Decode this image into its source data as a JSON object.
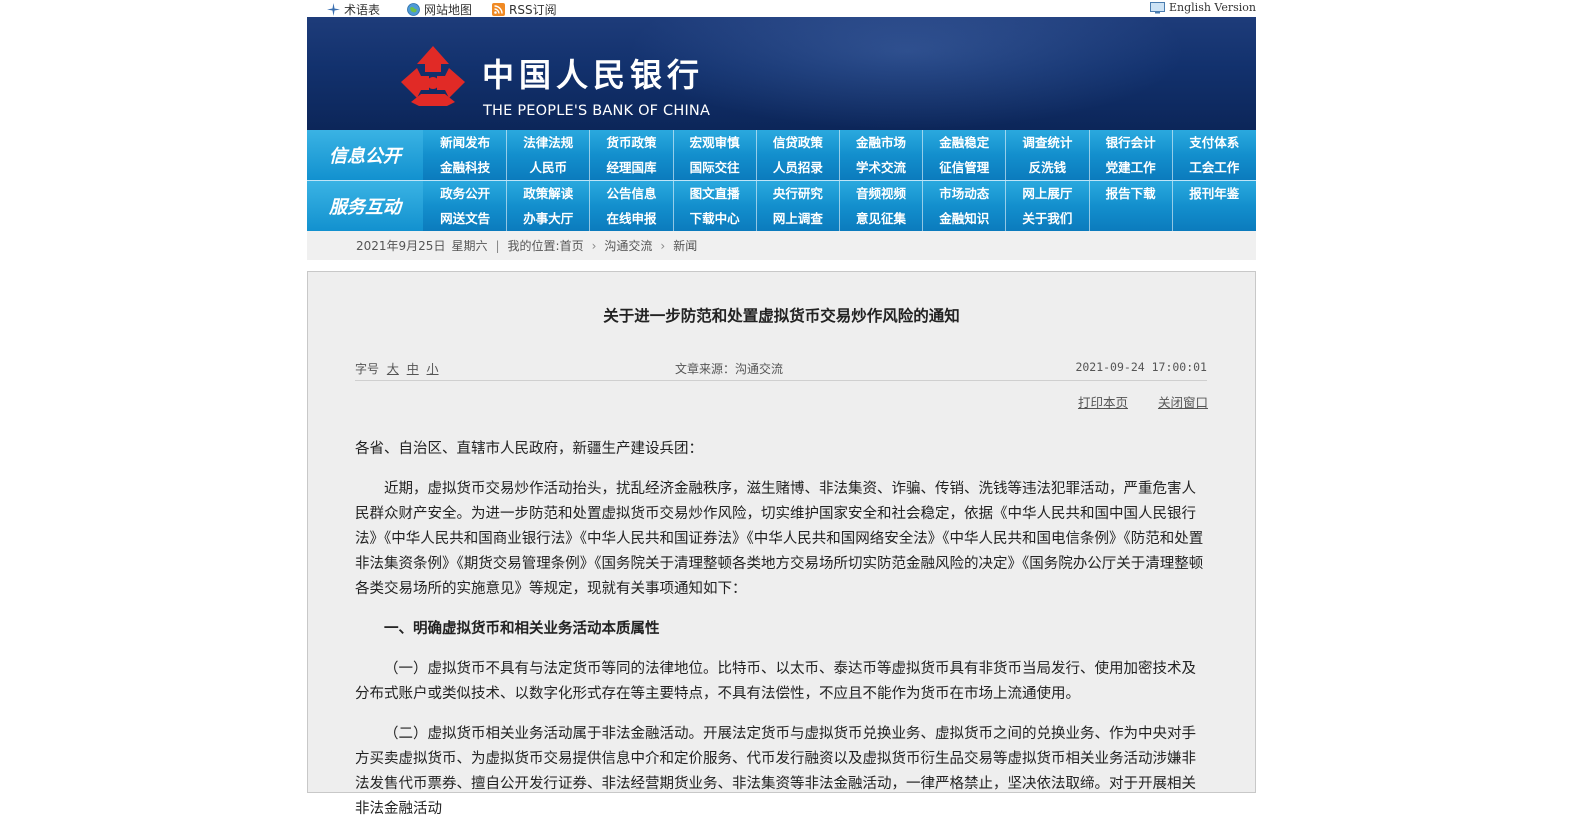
{
  "topbar": {
    "glossary": "术语表",
    "sitemap": "网站地图",
    "rss": "RSS订阅",
    "english": "English Version"
  },
  "banner": {
    "name_cn": "中国人民银行",
    "name_en": "THE PEOPLE'S BANK OF CHINA",
    "colors": {
      "emblem": "#e12a26",
      "banner_bg": "#12316d"
    }
  },
  "nav": {
    "info_title": "信息公开",
    "service_title": "服务互动",
    "info_row1": [
      "新闻发布",
      "法律法规",
      "货币政策",
      "宏观审慎",
      "信贷政策",
      "金融市场",
      "金融稳定",
      "调查统计",
      "银行会计",
      "支付体系"
    ],
    "info_row2": [
      "金融科技",
      "人民币",
      "经理国库",
      "国际交往",
      "人员招录",
      "学术交流",
      "征信管理",
      "反洗钱",
      "党建工作",
      "工会工作"
    ],
    "service_row1": [
      "政务公开",
      "政策解读",
      "公告信息",
      "图文直播",
      "央行研究",
      "音频视频",
      "市场动态",
      "网上展厅",
      "报告下载",
      "报刊年鉴"
    ],
    "service_row2": [
      "网送文告",
      "办事大厅",
      "在线申报",
      "下载中心",
      "网上调查",
      "意见征集",
      "金融知识",
      "关于我们"
    ]
  },
  "breadcrumb": {
    "date": "2021年9月25日",
    "weekday": "星期六",
    "location_label": "我的位置:",
    "home": "首页",
    "level1": "沟通交流",
    "level2": "新闻"
  },
  "article": {
    "title": "关于进一步防范和处置虚拟货币交易炒作风险的通知",
    "font_label": "字号",
    "font_large": "大",
    "font_medium": "中",
    "font_small": "小",
    "source": "文章来源：沟通交流",
    "datetime": "2021-09-24 17:00:01",
    "print": "打印本页",
    "close": "关闭窗口",
    "salutation": "各省、自治区、直辖市人民政府，新疆生产建设兵团：",
    "para1": "近期，虚拟货币交易炒作活动抬头，扰乱经济金融秩序，滋生赌博、非法集资、诈骗、传销、洗钱等违法犯罪活动，严重危害人民群众财产安全。为进一步防范和处置虚拟货币交易炒作风险，切实维护国家安全和社会稳定，依据《中华人民共和国中国人民银行法》《中华人民共和国商业银行法》《中华人民共和国证券法》《中华人民共和国网络安全法》《中华人民共和国电信条例》《防范和处置非法集资条例》《期货交易管理条例》《国务院关于清理整顿各类地方交易场所切实防范金融风险的决定》《国务院办公厅关于清理整顿各类交易场所的实施意见》等规定，现就有关事项通知如下：",
    "heading1": "一、明确虚拟货币和相关业务活动本质属性",
    "para2": "（一）虚拟货币不具有与法定货币等同的法律地位。比特币、以太币、泰达币等虚拟货币具有非货币当局发行、使用加密技术及分布式账户或类似技术、以数字化形式存在等主要特点，不具有法偿性，不应且不能作为货币在市场上流通使用。",
    "para3": "（二）虚拟货币相关业务活动属于非法金融活动。开展法定货币与虚拟货币兑换业务、虚拟货币之间的兑换业务、作为中央对手方买卖虚拟货币、为虚拟货币交易提供信息中介和定价服务、代币发行融资以及虚拟货币衍生品交易等虚拟货币相关业务活动涉嫌非法发售代币票券、擅自公开发行证券、非法经营期货业务、非法集资等非法金融活动，一律严格禁止，坚决依法取缔。对于开展相关非法金融活动"
  }
}
